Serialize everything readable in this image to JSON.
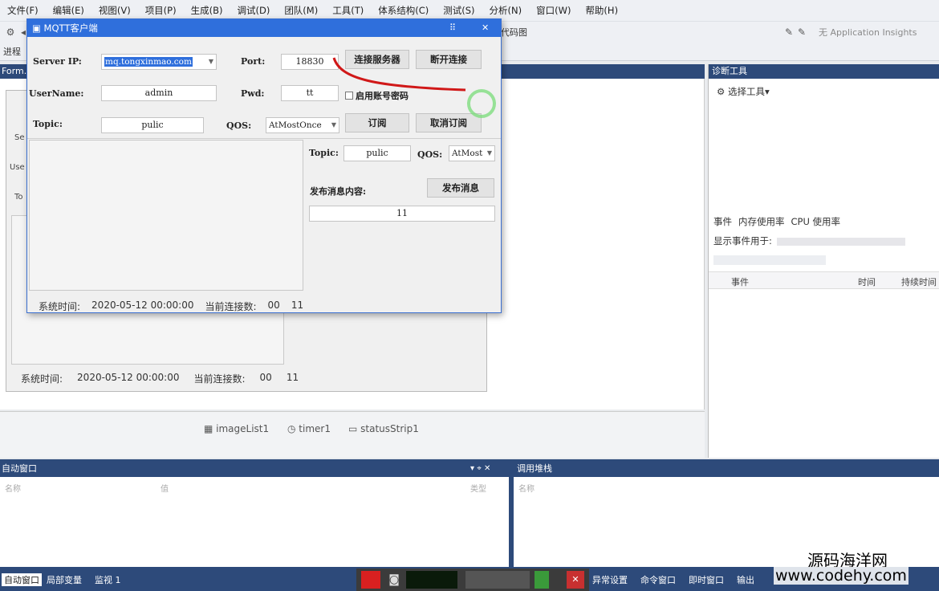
{
  "menu": [
    "文件(F)",
    "编辑(E)",
    "视图(V)",
    "项目(P)",
    "生成(B)",
    "调试(D)",
    "团队(M)",
    "工具(T)",
    "体系结构(C)",
    "测试(S)",
    "分析(N)",
    "窗口(W)",
    "帮助(H)"
  ],
  "toolbar": {
    "code_map": "代码图",
    "app_insights": "无 Application Insights",
    "process_label": "进程"
  },
  "design_tab": "Form...",
  "background_form": {
    "labels": [
      "Se",
      "Use",
      "To"
    ],
    "status_time_label": "系统时间:",
    "status_time_value": "2020-05-12 00:00:00",
    "status_conn_label": "当前连接数:",
    "status_conn_value": "00",
    "status_extra": "11"
  },
  "components": [
    "imageList1",
    "timer1",
    "statusStrip1"
  ],
  "diagnostics": {
    "title": "诊断工具",
    "select_tools": "选择工具",
    "tabs": [
      "事件",
      "内存使用率",
      "CPU 使用率"
    ],
    "show_events": "显示事件用于:",
    "columns": [
      "事件",
      "时间",
      "持续时间"
    ]
  },
  "auto_window": {
    "title": "自动窗口",
    "col_name": "名称",
    "col_value": "值",
    "col_type": "类型"
  },
  "call_stack": {
    "title": "调用堆栈",
    "col_name": "名称"
  },
  "bottom_tabs_left": [
    "自动窗口",
    "局部变量",
    "监视 1"
  ],
  "bottom_tabs_right": [
    "异常设置",
    "命令窗口",
    "即时窗口",
    "输出"
  ],
  "dialog": {
    "title": "MQTT客户端",
    "server_ip_label": "Server IP:",
    "server_ip_value": "mq.tongxinmao.com",
    "port_label": "Port:",
    "port_value": "18830",
    "connect_btn": "连接服务器",
    "disconnect_btn": "断开连接",
    "username_label": "UserName:",
    "username_value": "admin",
    "pwd_label": "Pwd:",
    "pwd_value": "tt",
    "enable_account": "启用账号密码",
    "topic_label": "Topic:",
    "topic_value": "pulic",
    "qos_label": "QOS:",
    "qos_value": "AtMostOnce",
    "subscribe_btn": "订阅",
    "unsubscribe_btn": "取消订阅",
    "pub_topic_label": "Topic:",
    "pub_topic_value": "pulic",
    "pub_qos_label": "QOS:",
    "pub_qos_value": "AtMost",
    "content_label": "发布消息内容:",
    "publish_btn": "发布消息",
    "content_value": "11",
    "status_time_label": "系统时间:",
    "status_time_value": "2020-05-12 00:00:00",
    "status_conn_label": "当前连接数:",
    "status_conn_value": "00",
    "status_extra": "11"
  },
  "watermark": {
    "cn": "源码海洋网",
    "url": "www.codehy.com"
  }
}
